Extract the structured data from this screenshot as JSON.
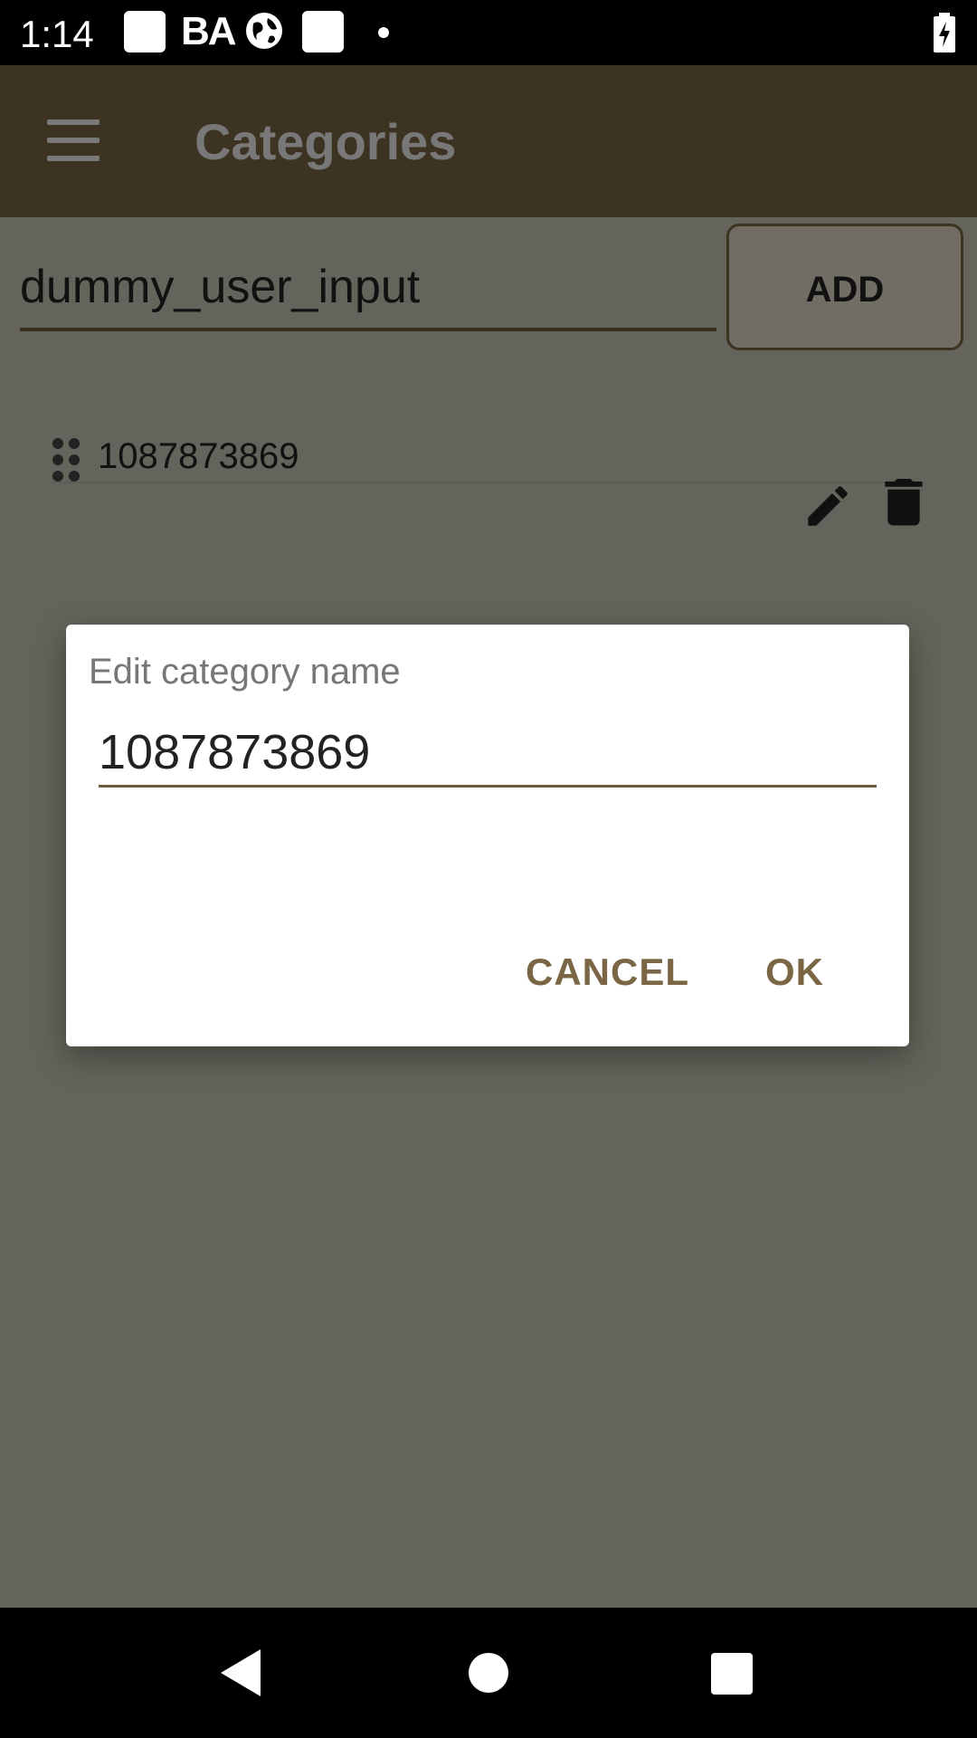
{
  "status_bar": {
    "time": "1:14",
    "carrier_text": "BA",
    "icons": [
      "notification-square-icon",
      "globe-icon",
      "notification-square-icon",
      "dot-icon",
      "battery-charging-icon"
    ]
  },
  "toolbar": {
    "title": "Categories",
    "menu_icon": "hamburger-menu-icon"
  },
  "new_category": {
    "value": "dummy_user_input",
    "add_label": "ADD"
  },
  "categories": [
    {
      "label": "1087873869"
    }
  ],
  "dialog": {
    "title": "Edit category name",
    "input_value": "1087873869",
    "cancel_label": "CANCEL",
    "ok_label": "OK"
  },
  "colors": {
    "accent": "#7a6645",
    "toolbar": "#7a6645",
    "background": "#c8c8b8"
  }
}
